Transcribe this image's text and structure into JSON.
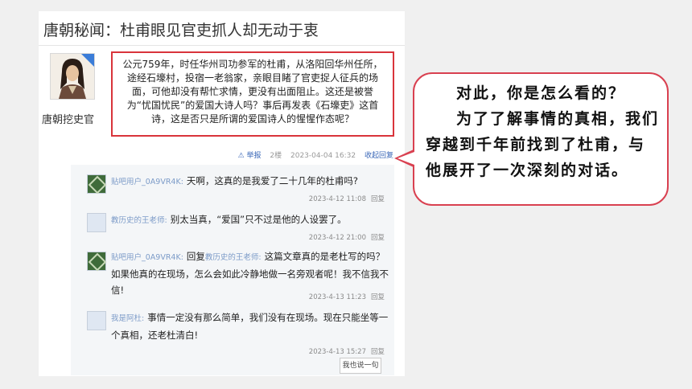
{
  "forum": {
    "title": "唐朝秘闻：杜甫眼见官吏抓人却无动于衷",
    "author": {
      "name": "唐朝挖史官"
    },
    "post": {
      "text": "公元759年，时任华州司功参军的杜甫，从洛阳回华州任所，途经石壕村，投宿一老翁家，亲眼目睹了官吏捉人征兵的场面，可他却没有帮忙求情，更没有出面阻止。这还是被誉为“忧国忧民”的爱国大诗人吗？事后再发表《石壕吏》这首诗，这是否只是所谓的爱国诗人的惺惺作态呢？"
    },
    "meta": {
      "report": "举报",
      "floor": "2楼",
      "time": "2023-04-04 16:32",
      "collapse": "收起回复"
    },
    "replies": [
      {
        "user": "贴吧用户_0A9VR4K:",
        "text": "天啊，这真的是我爱了二十几年的杜甫吗?",
        "time": "2023-4-12 11:08",
        "action": "回复"
      },
      {
        "user": "教历史的王老师:",
        "text": "别太当真，“爱国”只不过是他的人设罢了。",
        "time": "2023-4-12 21:00",
        "action": "回复"
      },
      {
        "user": "贴吧用户_0A9VR4K:",
        "reply_prefix": "回复",
        "reply_to": "教历史的王老师:",
        "text": "这篇文章真的是老杜写的吗？如果他真的在现场，怎么会如此冷静地做一名旁观者呢！我不信我不信!",
        "time": "2023-4-13 11:23",
        "action": "回复"
      },
      {
        "user": "我是阿杜:",
        "text": "事情一定没有那么简单，我们没有在现场。现在只能坐等一个真相，还老杜清白!",
        "time": "2023-4-13 15:27",
        "action": "回复"
      }
    ],
    "say_button": "我也说一句"
  },
  "bubble": {
    "line1": "对此，你是怎么看的？",
    "line2": "为了了解事情的真相，我们穿越到千年前找到了杜甫，与他展开了一次深刻的对话。"
  },
  "colors": {
    "accent_red": "#d9343b",
    "link_blue": "#3b68b8",
    "username_blue": "#7c9bc8"
  }
}
